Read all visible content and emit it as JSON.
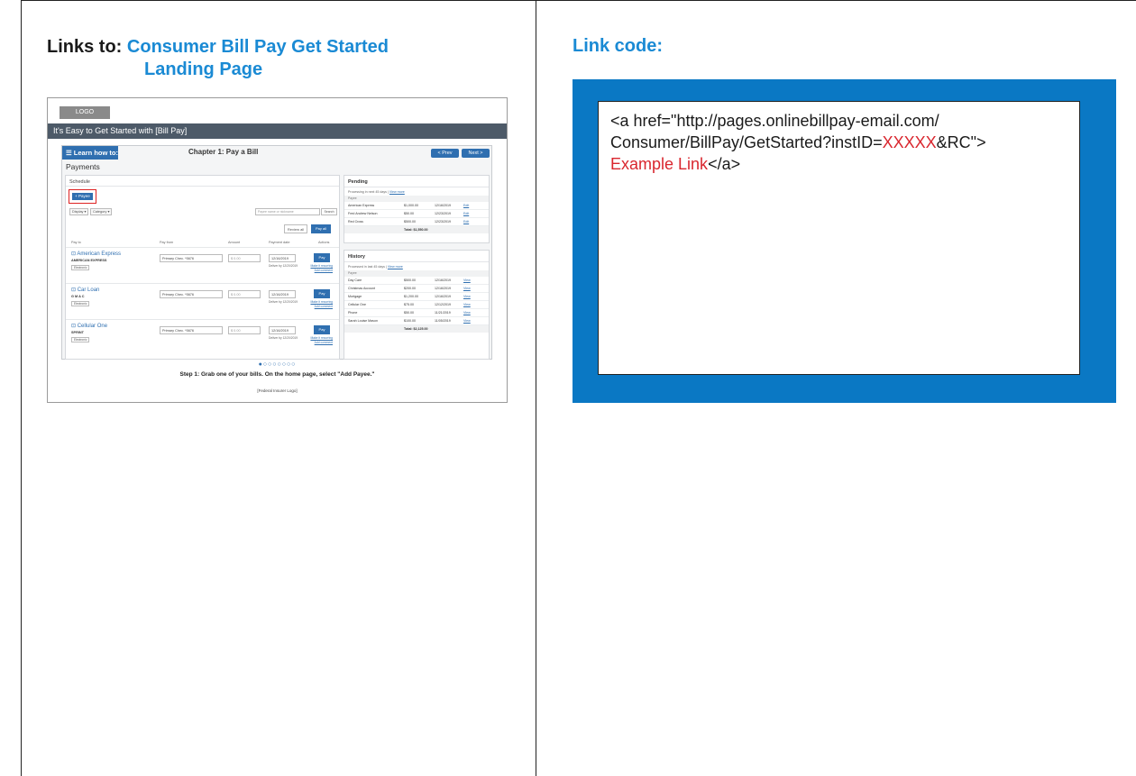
{
  "left": {
    "heading_label": "Links to:",
    "heading_link_line1": "Consumer Bill Pay Get Started",
    "heading_link_line2": "Landing Page"
  },
  "thumbnail": {
    "logo": "LOGO",
    "banner": "It's Easy to Get Started with [Bill Pay]",
    "learn_how": "☰ Learn how to:",
    "chapter": "Chapter 1: Pay a Bill",
    "prev": "< Prev",
    "next": "Next >",
    "payments": "Payments",
    "schedule": "Schedule",
    "add_payee": "+ Payee",
    "filter1": "Display ▾",
    "filter2": "Category ▾",
    "search_placeholder": "Payee name or nickname",
    "search_btn": "Search",
    "review_all": "Review all",
    "pay_all": "Pay all",
    "col_payto": "Pay to",
    "col_payfrom": "Pay from",
    "col_amount": "Amount",
    "col_date": "Payment date",
    "col_actions": "Actions",
    "rows": [
      {
        "name": "⊡ American Express",
        "sub": "AMERICAN EXPRESS",
        "tag": "Electronic",
        "from": "Primary Chec. *5676",
        "amount": "$ 0.00",
        "date": "12/16/2019",
        "deliver": "Deliver by 12/20/2019",
        "pay": "Pay",
        "action1": "Make it recurring",
        "action2": "Add comment"
      },
      {
        "name": "⊡ Car Loan",
        "sub": "G M A C",
        "tag": "Electronic",
        "from": "Primary Chec. *5676",
        "amount": "$ 0.00",
        "date": "12/16/2019",
        "deliver": "Deliver by 12/20/2019",
        "pay": "Pay",
        "action1": "Make it recurring",
        "action2": "Add comment"
      },
      {
        "name": "⊡ Cellular One",
        "sub": "SPRINT",
        "tag": "Electronic",
        "from": "Primary Chec. *5676",
        "amount": "$ 0.00",
        "date": "12/16/2019",
        "deliver": "Deliver by 12/20/2019",
        "pay": "Pay",
        "action1": "Make it recurring",
        "action2": "Add comment"
      }
    ],
    "pending": {
      "title": "Pending",
      "note": "Processing in next 45 days |",
      "note_link": "View more",
      "col": "Payee",
      "rows": [
        {
          "payee": "American Express",
          "amount": "$1,000.00",
          "date": "12/16/2019",
          "action": "Edit"
        },
        {
          "payee": "Fred Andrew Nelson",
          "amount": "$50.00",
          "date": "12/23/2019",
          "action": "Edit"
        },
        {
          "payee": "Red Cross",
          "amount": "$500.00",
          "date": "12/23/2019",
          "action": "Edit"
        }
      ],
      "total": "Total: $1,550.00"
    },
    "history": {
      "title": "History",
      "note": "Processed in last 45 days |",
      "note_link": "View more",
      "col": "Payee",
      "rows": [
        {
          "payee": "Day Care",
          "amount": "$500.00",
          "date": "12/16/2019",
          "action": "View"
        },
        {
          "payee": "Christmas Account",
          "amount": "$200.00",
          "date": "12/16/2019",
          "action": "View"
        },
        {
          "payee": "Mortgage",
          "amount": "$1,200.00",
          "date": "12/16/2019",
          "action": "View"
        },
        {
          "payee": "Cellular One",
          "amount": "$75.00",
          "date": "12/12/2019",
          "action": "View"
        },
        {
          "payee": "Phone",
          "amount": "$50.00",
          "date": "11/21/2019",
          "action": "View"
        },
        {
          "payee": "Sarah Louise Mason",
          "amount": "$100.00",
          "date": "11/05/2019",
          "action": "View"
        }
      ],
      "total": "Total: $2,125.00"
    },
    "carousel_dots": "●○○○○○○○",
    "step_text": "Step 1: Grab one of your bills. On the home page, select \"Add Payee.\"",
    "fed_logo": "[Federal Insurer Logo]"
  },
  "right": {
    "heading": "Link code:",
    "code_part1": "<a href=\"http://pages.onlinebillpay-email.com/",
    "code_part2": "Consumer/BillPay/GetStarted?instID=",
    "code_red1": "XXXXX",
    "code_part3": "&RC\">",
    "code_red2": "Example Link",
    "code_part4": "</a>"
  },
  "colors": {
    "heading_blue": "#1a8ad4",
    "code_frame_blue": "#0a78c4",
    "placeholder_red": "#d9262e"
  }
}
